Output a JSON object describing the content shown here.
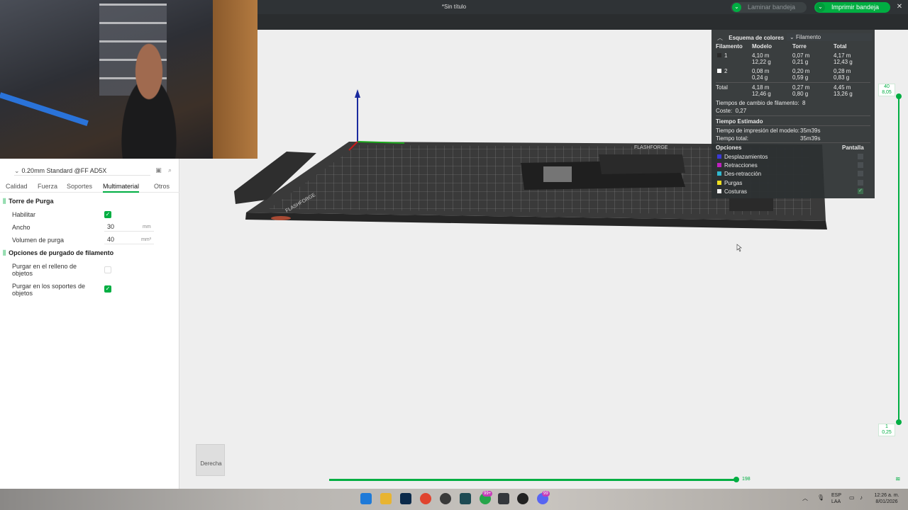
{
  "window": {
    "title": "*Sin título"
  },
  "toolbar": {
    "slice_label": "Laminar bandeja",
    "print_label": "Imprimir bandeja"
  },
  "left_panel": {
    "preset": "0.20mm Standard @FF AD5X",
    "tabs": [
      "Calidad",
      "Fuerza",
      "Soportes",
      "Multimaterial",
      "Otros"
    ],
    "active_tab": "Multimaterial",
    "prime_tower": {
      "title": "Torre de Purga",
      "enable_label": "Habilitar",
      "enable_checked": true,
      "width_label": "Ancho",
      "width_value": "30",
      "width_unit": "mm",
      "volume_label": "Volumen de purga",
      "volume_value": "40",
      "volume_unit": "mm³"
    },
    "purge_options": {
      "title": "Opciones de purgado de filamento",
      "infill_label_1": "Purgar en el relleno de",
      "infill_label_2": "objetos",
      "infill_checked": false,
      "support_label_1": "Purgar en los soportes de",
      "support_label_2": "objetos",
      "support_checked": true
    }
  },
  "stats": {
    "header": "Esquema de colores",
    "dropdown": "Filamento",
    "columns": [
      "Filamento",
      "Modelo",
      "Torre",
      "Total"
    ],
    "rows": [
      {
        "id": "1",
        "swatch": "#2b2b2b",
        "model_m": "4,10 m",
        "model_g": "12,22 g",
        "tower_m": "0,07 m",
        "tower_g": "0,21 g",
        "total_m": "4,17 m",
        "total_g": "12,43 g"
      },
      {
        "id": "2",
        "swatch": "#ffffff",
        "model_m": "0,08 m",
        "model_g": "0,24 g",
        "tower_m": "0,20 m",
        "tower_g": "0,59 g",
        "total_m": "0,28 m",
        "total_g": "0,83 g"
      }
    ],
    "total": {
      "label": "Total",
      "model_m": "4,18 m",
      "model_g": "12,46 g",
      "tower_m": "0,27 m",
      "tower_g": "0,80 g",
      "total_m": "4,45 m",
      "total_g": "13,26 g"
    },
    "changes_label": "Tiempos de cambio de filamento:",
    "changes_value": "8",
    "cost_label": "Coste:",
    "cost_value": "0,27",
    "time_header": "Tiempo Estimado",
    "model_time_label": "Tiempo de impresión del modelo:",
    "model_time_value": "35m39s",
    "total_time_label": "Tiempo total:",
    "total_time_value": "35m39s",
    "options_header": "Opciones",
    "display_header": "Pantalla",
    "options": [
      {
        "label": "Desplazamientos",
        "color": "#3a3ad8",
        "checked": false
      },
      {
        "label": "Retracciones",
        "color": "#c020c0",
        "checked": false
      },
      {
        "label": "Des-retracción",
        "color": "#30b8d0",
        "checked": false
      },
      {
        "label": "Purgas",
        "color": "#f0e020",
        "checked": false
      },
      {
        "label": "Costuras",
        "color": "#f0f0f0",
        "checked": true
      }
    ]
  },
  "layer_slider": {
    "top_layer": "40",
    "top_height": "8,05",
    "bottom_layer": "1",
    "bottom_height": "0,25",
    "h_value": "198"
  },
  "view_cube": {
    "label": "Derecha"
  },
  "bed": {
    "logo_text": "FLASHFORGE"
  },
  "taskbar": {
    "lang_1": "ESP",
    "lang_2": "LAA",
    "time": "12:26 a. m.",
    "date": "8/01/2026",
    "badge_1": "99+",
    "badge_2": "99"
  }
}
